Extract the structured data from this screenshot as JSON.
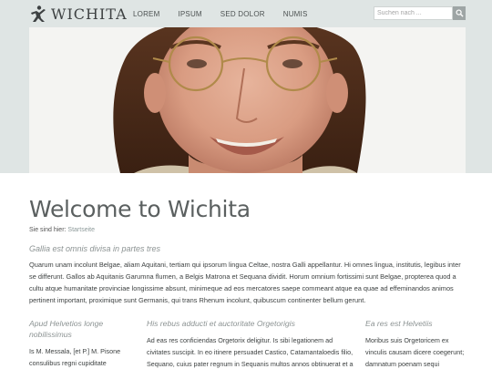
{
  "header": {
    "brand": "WICHITA",
    "nav": [
      "LOREM",
      "IPSUM",
      "SED DOLOR",
      "NUMIS"
    ],
    "search_placeholder": "Suchen nach ..."
  },
  "page": {
    "title": "Welcome to Wichita",
    "breadcrumb_prefix": "Sie sind hier:",
    "breadcrumb_link": "Startseite",
    "intro_heading": "Gallia est omnis divisa in partes tres",
    "intro_text": "Quarum unam incolunt Belgae, aliam Aquitani, tertiam qui ipsorum lingua Celtae, nostra Galli appellantur. Hi omnes lingua, institutis, legibus inter se differunt. Gallos ab Aquitanis Garumna flumen, a Belgis Matrona et Sequana dividit. Horum omnium fortissimi sunt Belgae, propterea quod a cultu atque humanitate provinciae longissime absunt, minimeque ad eos mercatores saepe commeant atque ea quae ad effeminandos animos pertinent important, proximique sunt Germanis, qui trans Rhenum incolunt, quibuscum continenter bellum gerunt."
  },
  "columns": [
    {
      "heading": "Apud Helvetios longe nobilissimus",
      "text": "Is M. Messala, [et P.] M. Pisone consulibus regni cupiditate"
    },
    {
      "heading": "His rebus adducti et auctoritate Orgetorigis",
      "text": "Ad eas res conficiendas Orgetorix deligitur. Is sibi legationem ad civitates suscipit. In eo itinere persuadet Castico, Catamantaloedis filio, Sequano, cuius pater regnum in Sequanis multos annos obtinuerat et a"
    },
    {
      "heading": "Ea res est Helvetiis",
      "text": "Moribus suis Orgetoricem ex vinculis causam dicere coegerunt; damnatum poenam sequi"
    }
  ],
  "colors": {
    "header_bg": "#dfe5e4",
    "title": "#5b6060",
    "subheading": "#8c9393",
    "link": "#8d9a9a"
  },
  "icons": {
    "logo": "running-figure-logo",
    "search": "search-icon"
  }
}
